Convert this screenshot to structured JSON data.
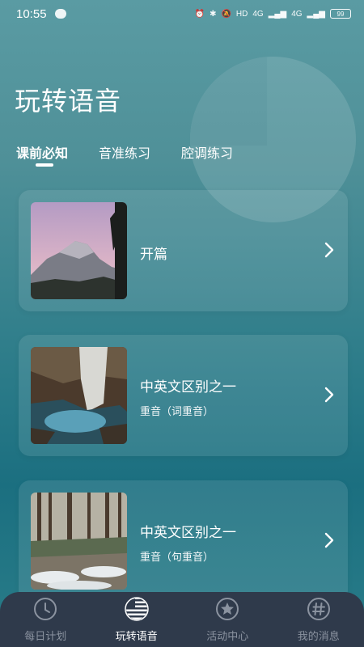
{
  "status_bar": {
    "time": "10:55",
    "hd": "HD",
    "net1": "4G",
    "net2": "4G",
    "battery": "99"
  },
  "page": {
    "title": "玩转语音"
  },
  "tabs": [
    {
      "label": "课前必知",
      "active": true
    },
    {
      "label": "音准练习",
      "active": false
    },
    {
      "label": "腔调练习",
      "active": false
    }
  ],
  "cards": [
    {
      "title": "开篇",
      "subtitle": "",
      "thumb": "mountain-dome-photo"
    },
    {
      "title": "中英文区别之一",
      "subtitle": "重音（词重音）",
      "thumb": "waterfall-photo"
    },
    {
      "title": "中英文区别之一",
      "subtitle": "重音（句重音）",
      "thumb": "river-forest-photo"
    }
  ],
  "bottom_nav": [
    {
      "label": "每日计划",
      "icon": "clock-icon",
      "active": false
    },
    {
      "label": "玩转语音",
      "icon": "us-flag-icon",
      "active": true
    },
    {
      "label": "活动中心",
      "icon": "star-icon",
      "active": false
    },
    {
      "label": "我的消息",
      "icon": "hashtag-icon",
      "active": false
    }
  ],
  "colors": {
    "nav_bg": "#2f3a4b",
    "nav_inactive": "#8b93a0",
    "text": "#ffffff"
  }
}
